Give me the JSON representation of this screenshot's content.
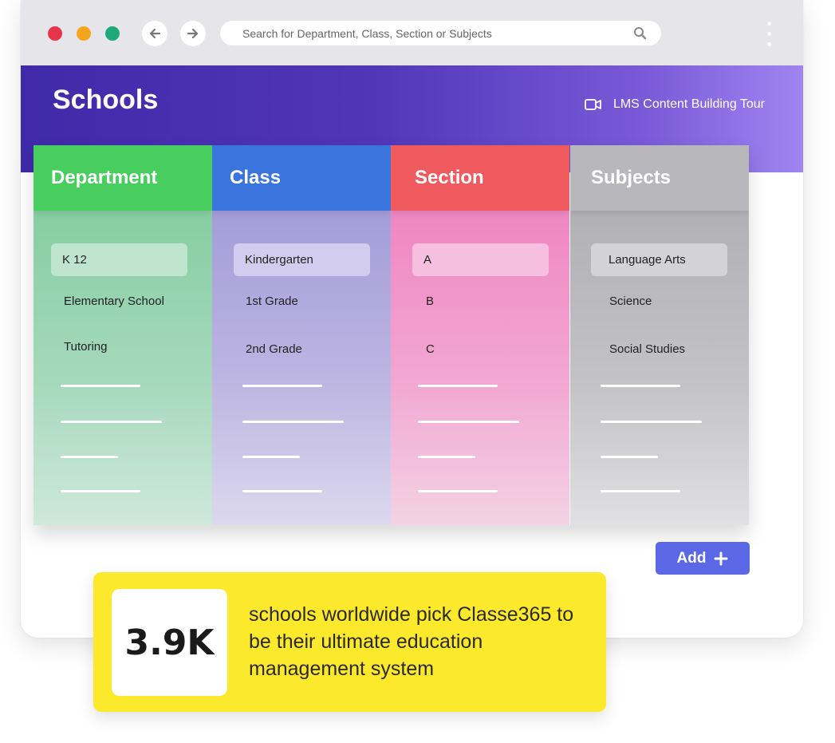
{
  "browser": {
    "search_placeholder": "Search for Department, Class, Section or Subjects"
  },
  "header": {
    "title": "Schools",
    "tour_label": "LMS Content Building Tour"
  },
  "columns": [
    {
      "title": "Department",
      "items": [
        "K 12",
        "Elementary School",
        "Tutoring"
      ],
      "selected": 0,
      "head_color": "#47ce5e"
    },
    {
      "title": "Class",
      "items": [
        "Kindergarten",
        "1st Grade",
        "2nd Grade"
      ],
      "selected": 0,
      "head_color": "#3a75dd"
    },
    {
      "title": "Section",
      "items": [
        "A",
        "B",
        "C"
      ],
      "selected": 0,
      "head_color": "#ef5a5e"
    },
    {
      "title": "Subjects",
      "items": [
        "Language Arts",
        "Science",
        "Social Studies"
      ],
      "selected": 0,
      "head_color": "#b8b8bc"
    }
  ],
  "add_button": {
    "label": "Add"
  },
  "promo": {
    "stat": "3.9K",
    "text": "schools worldwide pick Classe365 to be their ultimate education management system"
  }
}
